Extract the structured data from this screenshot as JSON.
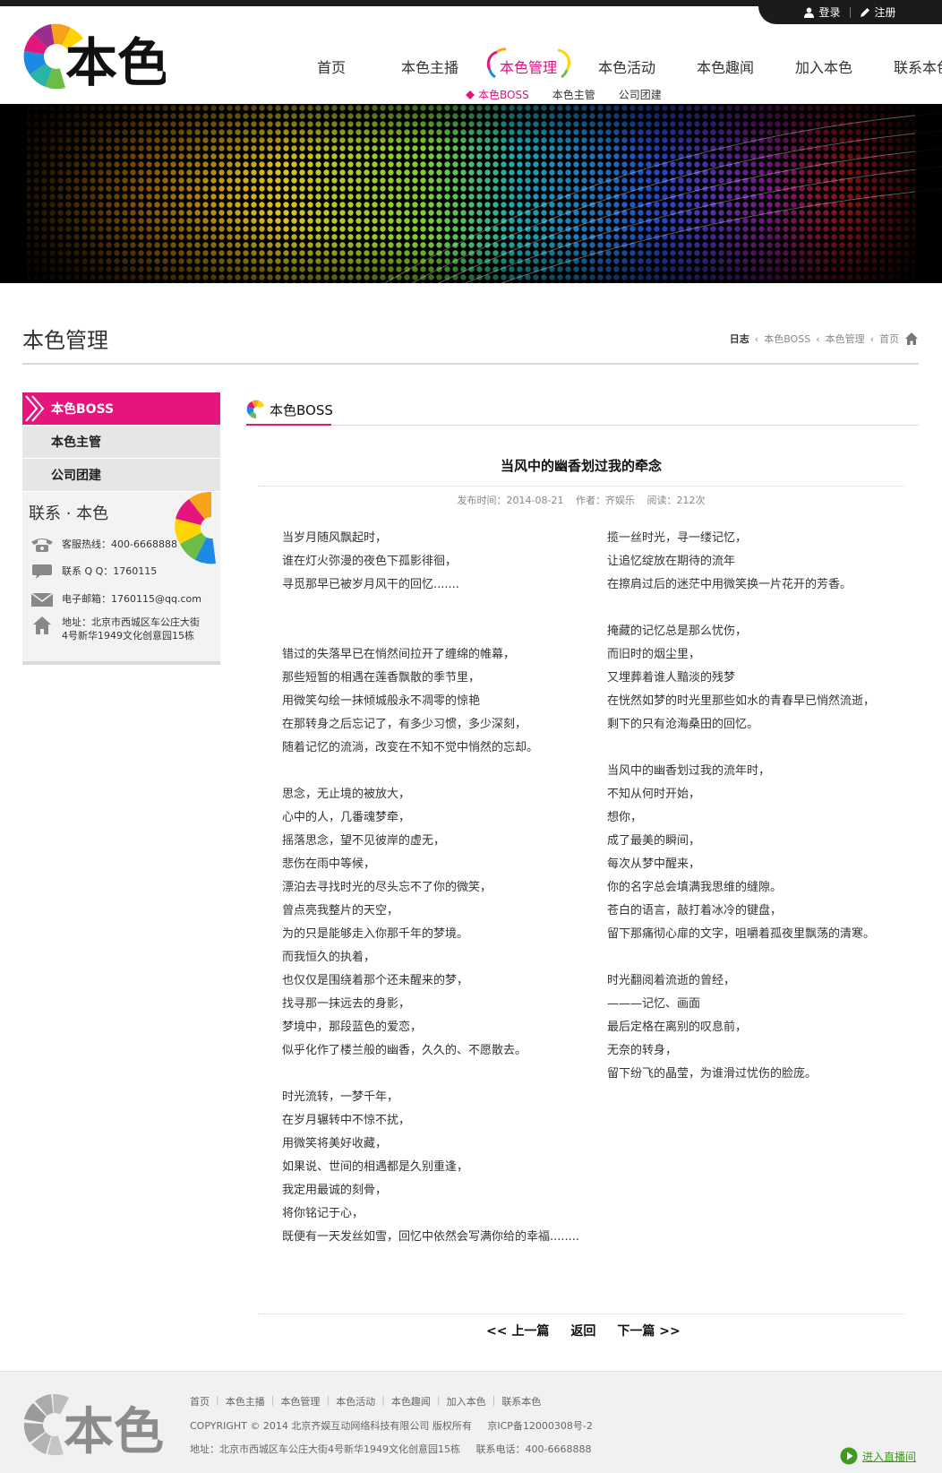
{
  "header": {
    "login": "登录",
    "register": "注册",
    "logo_text": "本色",
    "nav": [
      "首页",
      "本色主播",
      "本色管理",
      "本色活动",
      "本色趣闻",
      "加入本色",
      "联系本色"
    ],
    "subnav": [
      "本色BOSS",
      "本色主管",
      "公司团建"
    ]
  },
  "page": {
    "title": "本色管理",
    "breadcrumb": [
      "日志",
      "本色BOSS",
      "本色管理",
      "首页"
    ]
  },
  "sidebar": {
    "items": [
      "本色BOSS",
      "本色主管",
      "公司团建"
    ],
    "contact_title": "联系 · 本色",
    "hotline": "客服热线：400-6668888",
    "qq": "联系 Q Q：1760115",
    "email": "电子邮箱：1760115@qq.com",
    "address_line1": "地址：北京市西城区车公庄大街",
    "address_line2": "4号新华1949文化创意园15栋"
  },
  "content": {
    "section_title": "本色BOSS",
    "article_title": "当风中的幽香划过我的牵念",
    "meta_date": "发布时间：2014-08-21",
    "meta_author": "作者：齐娱乐",
    "meta_views": "阅读：212次",
    "left_lines": [
      "当岁月随风飘起时，",
      "谁在灯火弥漫的夜色下孤影徘徊，",
      "寻觅那早已被岁月风干的回忆.......",
      "",
      "",
      "错过的失落早已在悄然间拉开了缠绵的帷幕，",
      "那些短暂的相遇在莲香飘散的季节里，",
      "用微笑勾绘一抹倾城般永不凋零的惊艳",
      "在那转身之后忘记了，有多少习惯，多少深刻，",
      "随着记忆的流淌，改变在不知不觉中悄然的忘却。",
      "",
      "思念，无止境的被放大，",
      "心中的人，几番魂梦牵，",
      "摇落思念，望不见彼岸的虚无，",
      "悲伤在雨中等候，",
      "漂泊去寻找时光的尽头忘不了你的微笑，",
      "曾点亮我整片的天空，",
      "为的只是能够走入你那千年的梦境。",
      "而我恒久的执着，",
      "也仅仅是围绕着那个还未醒来的梦，",
      "找寻那一抹远去的身影，",
      "梦境中，那段蓝色的爱恋，",
      "似乎化作了楼兰般的幽香，久久的、不愿散去。",
      "",
      "时光流转，一梦千年，",
      "在岁月辗转中不惊不扰，",
      "用微笑将美好收藏，",
      "如果说、世间的相遇都是久别重逢，",
      "我定用最诚的刻骨，",
      "将你铭记于心，",
      "既便有一天发丝如雪，回忆中依然会写满你给的幸福........"
    ],
    "right_lines": [
      "揽一丝时光，寻一缕记忆，",
      "让追忆绽放在期待的流年",
      "在擦肩过后的迷茫中用微笑换一片花开的芳香。",
      "",
      "掩藏的记忆总是那么忧伤，",
      "而旧时的烟尘里，",
      "又埋葬着谁人黯淡的残梦",
      "在恍然如梦的时光里那些如水的青春早已悄然流逝，",
      "剩下的只有沧海桑田的回忆。",
      "",
      "当风中的幽香划过我的流年时，",
      "不知从何时开始，",
      "想你，",
      "成了最美的瞬间，",
      "每次从梦中醒来，",
      "你的名字总会填满我思维的缝隙。",
      "苍白的语言，敲打着冰冷的键盘，",
      "留下那痛彻心扉的文字，咀嚼着孤夜里飘荡的清寒。",
      "",
      "时光翻阅着流逝的曾经，",
      "———记忆、画面",
      "最后定格在离别的叹息前，",
      "无奈的转身，",
      "留下纷飞的晶莹，为谁滑过忧伤的脸庞。"
    ],
    "prev": "<<  上一篇",
    "back": "返回",
    "next": "下一篇  >>"
  },
  "footer": {
    "links": [
      "首页",
      "本色主播",
      "本色管理",
      "本色活动",
      "本色趣闻",
      "加入本色",
      "联系本色"
    ],
    "copyright": "COPYRIGHT © 2014 北京齐娱互动网络科技有限公司 版权所有",
    "icp": "京ICP备12000308号-2",
    "address": "地址：北京市西城区车公庄大街4号新华1949文化创意园15栋",
    "phone": "联系电话：400-6668888",
    "live": "进入直播间"
  },
  "colors": {
    "accent": "#e5157e",
    "dark": "#1b1b1b",
    "live_green": "#3f9b1d"
  }
}
